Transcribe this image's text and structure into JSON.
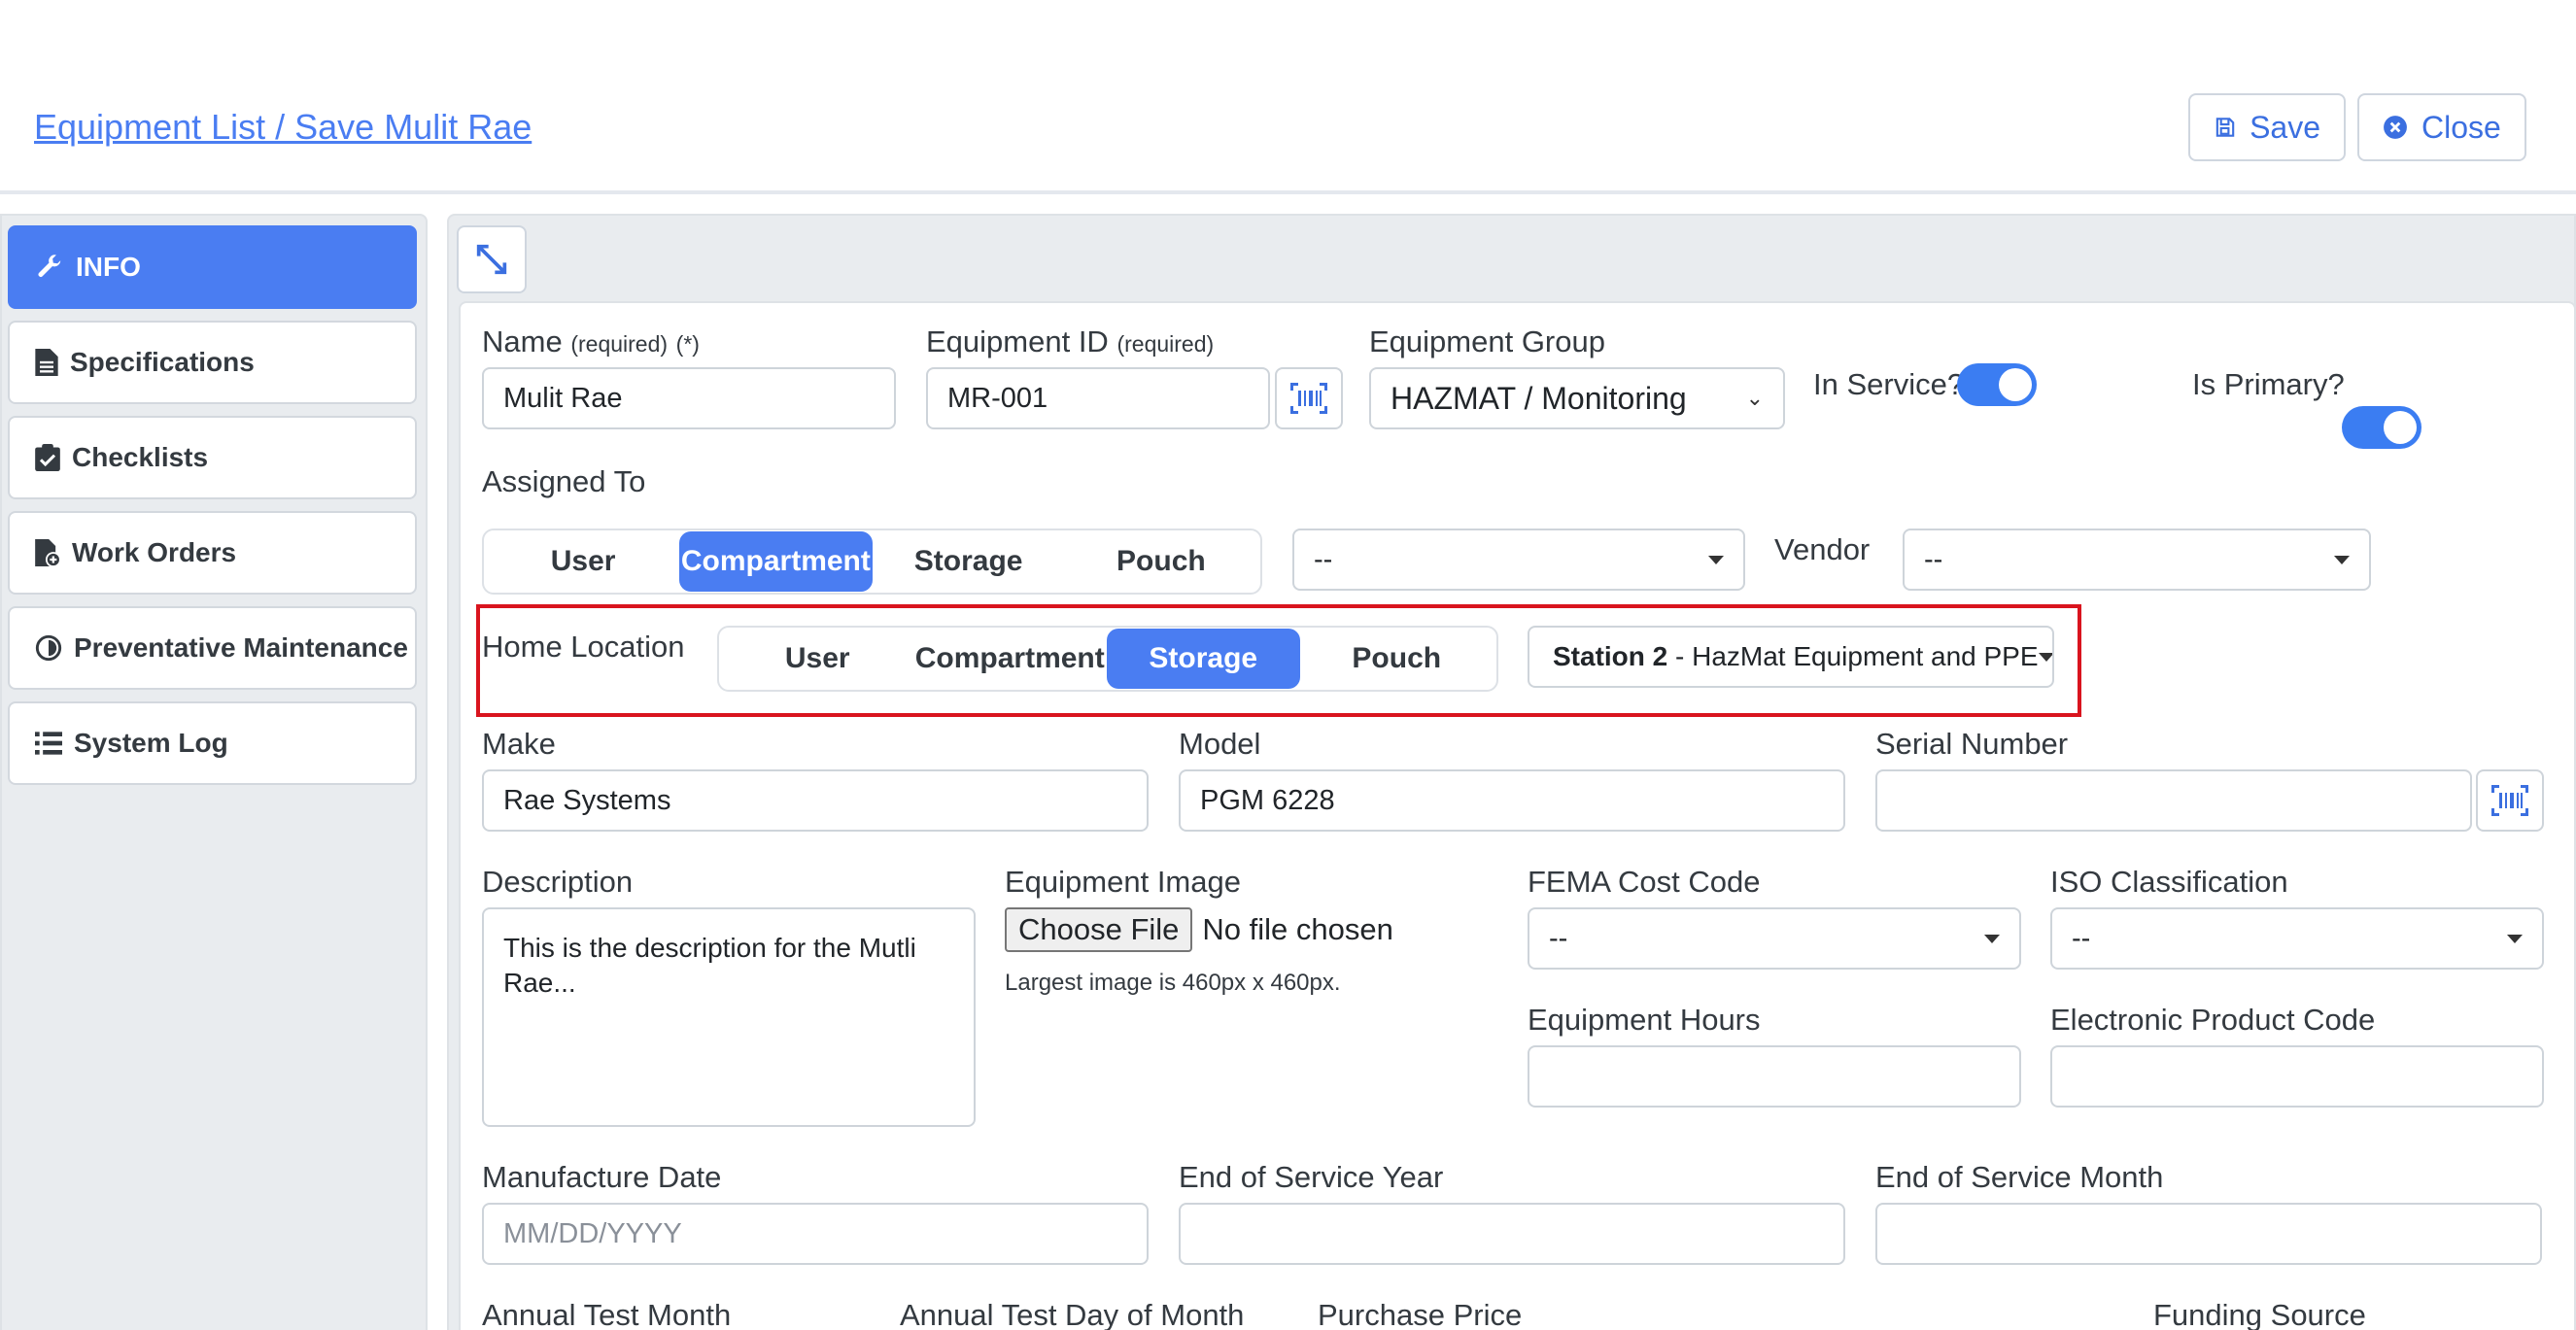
{
  "header": {
    "breadcrumb": "Equipment List / Save Mulit Rae",
    "save_label": "Save",
    "close_label": "Close"
  },
  "sidebar": {
    "items": [
      {
        "label": "INFO",
        "icon": "wrench-icon",
        "active": true
      },
      {
        "label": "Specifications",
        "icon": "file-icon"
      },
      {
        "label": "Checklists",
        "icon": "clipboard-check-icon"
      },
      {
        "label": "Work Orders",
        "icon": "file-plus-icon"
      },
      {
        "label": "Preventative Maintenance",
        "icon": "circle-half-icon"
      },
      {
        "label": "System Log",
        "icon": "list-icon"
      }
    ]
  },
  "form": {
    "name": {
      "label": "Name",
      "required": "(required)",
      "star": "(*)",
      "value": "Mulit Rae"
    },
    "equipment_id": {
      "label": "Equipment ID",
      "required": "(required)",
      "value": "MR-001"
    },
    "equipment_group": {
      "label": "Equipment Group",
      "value": "HAZMAT / Monitoring"
    },
    "in_service": {
      "label": "In Service?",
      "on": true
    },
    "is_primary": {
      "label": "Is Primary?",
      "on": true
    },
    "assigned_to": {
      "label": "Assigned To",
      "options": [
        "User",
        "Compartment",
        "Storage",
        "Pouch"
      ],
      "selected": "Compartment",
      "select_value": "--"
    },
    "vendor": {
      "label": "Vendor",
      "value": "--"
    },
    "home_location": {
      "label": "Home Location",
      "options": [
        "User",
        "Compartment",
        "Storage",
        "Pouch"
      ],
      "selected": "Storage",
      "select_bold": "Station 2",
      "select_rest": " - HazMat Equipment and PPE"
    },
    "make": {
      "label": "Make",
      "value": "Rae Systems"
    },
    "model": {
      "label": "Model",
      "value": "PGM 6228"
    },
    "serial_number": {
      "label": "Serial Number",
      "value": ""
    },
    "description": {
      "label": "Description",
      "value": "This is the description for the Mutli Rae..."
    },
    "equipment_image": {
      "label": "Equipment Image",
      "button": "Choose File",
      "status": "No file chosen",
      "hint": "Largest image is 460px x 460px."
    },
    "fema_cost_code": {
      "label": "FEMA Cost Code",
      "value": "--"
    },
    "iso_classification": {
      "label": "ISO Classification",
      "value": "--"
    },
    "equipment_hours": {
      "label": "Equipment Hours",
      "value": ""
    },
    "electronic_product_code": {
      "label": "Electronic Product Code",
      "value": ""
    },
    "manufacture_date": {
      "label": "Manufacture Date",
      "placeholder": "MM/DD/YYYY"
    },
    "end_of_service_year": {
      "label": "End of Service Year",
      "value": ""
    },
    "end_of_service_month": {
      "label": "End of Service Month",
      "value": ""
    },
    "annual_test_month": {
      "label": "Annual Test Month"
    },
    "annual_test_day": {
      "label": "Annual Test Day of Month"
    },
    "purchase_price": {
      "label": "Purchase Price"
    },
    "funding_source": {
      "label": "Funding Source"
    }
  },
  "colors": {
    "accent": "#4a7df2",
    "highlight": "#d9141e",
    "toggle": "#3b7df2"
  }
}
